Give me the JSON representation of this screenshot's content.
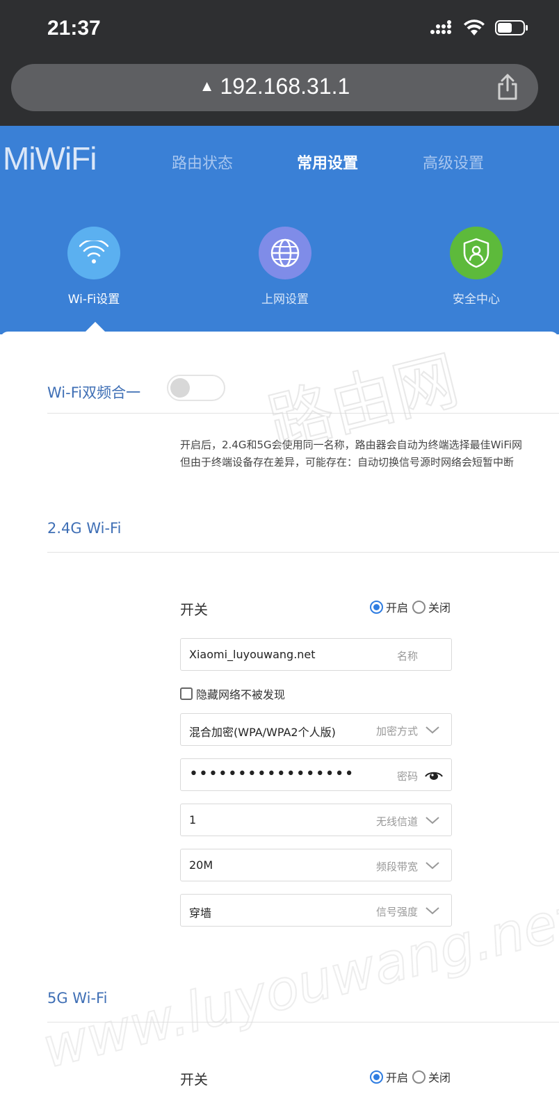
{
  "status_bar": {
    "time": "21:37"
  },
  "browser": {
    "url": "192.168.31.1",
    "warning_symbol": "▲"
  },
  "header": {
    "logo": "MiWiFi",
    "nav": [
      {
        "label": "路由状态"
      },
      {
        "label": "常用设置",
        "active": true
      },
      {
        "label": "高级设置"
      }
    ],
    "features": [
      {
        "label": "Wi-Fi设置",
        "color": "#5bb0f0",
        "active": true
      },
      {
        "label": "上网设置",
        "color": "#7f8ce8"
      },
      {
        "label": "安全中心",
        "color": "#5dba3b"
      }
    ]
  },
  "dual_band": {
    "title": "Wi-Fi双频合一",
    "enabled": false,
    "desc_line1": "开启后，2.4G和5G会使用同一名称，路由器会自动为终端选择最佳WiFi网",
    "desc_line2": "但由于终端设备存在差异，可能存在：自动切换信号源时网络会短暂中断"
  },
  "wifi24": {
    "title": "2.4G Wi-Fi",
    "switch_label": "开关",
    "on_label": "开启",
    "off_label": "关闭",
    "ssid": "Xiaomi_luyouwang.net",
    "ssid_hint": "名称",
    "hide_label": "隐藏网络不被发现",
    "encryption": "混合加密(WPA/WPA2个人版)",
    "encryption_hint": "加密方式",
    "password": "•••••••••••••••••",
    "password_hint": "密码",
    "channel": "1",
    "channel_hint": "无线信道",
    "bandwidth": "20M",
    "bandwidth_hint": "频段带宽",
    "signal": "穿墙",
    "signal_hint": "信号强度"
  },
  "wifi5": {
    "title": "5G Wi-Fi",
    "switch_label": "开关",
    "on_label": "开启",
    "off_label": "关闭"
  },
  "watermark": {
    "main": "路由网",
    "url": "www.luyouwang.net"
  }
}
